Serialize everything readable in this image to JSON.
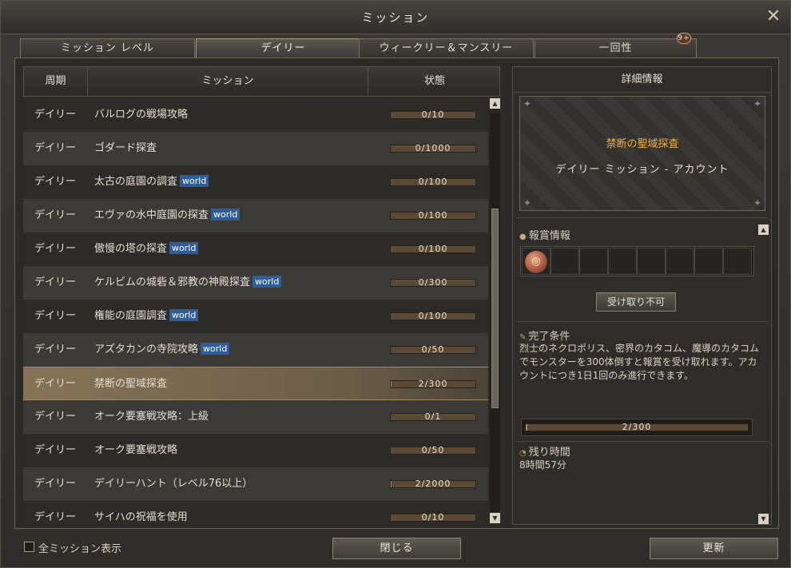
{
  "window": {
    "title": "ミッション",
    "close_glyph": "✕"
  },
  "tabs": [
    {
      "label": "ミッション レベル"
    },
    {
      "label": "デイリー"
    },
    {
      "label": "ウィークリー＆マンスリー"
    },
    {
      "label": "一回性",
      "badge": "9+"
    }
  ],
  "table": {
    "headers": [
      "周期",
      "ミッション",
      "状態"
    ],
    "rows": [
      {
        "period": "デイリー",
        "name": "バルログの戦場攻略",
        "world": "",
        "progress": "0/10",
        "ratio": 0
      },
      {
        "period": "デイリー",
        "name": "ゴダード探査",
        "world": "",
        "progress": "0/1000",
        "ratio": 0
      },
      {
        "period": "デイリー",
        "name": "太古の庭園の調査",
        "world": "world",
        "progress": "0/100",
        "ratio": 0
      },
      {
        "period": "デイリー",
        "name": "エヴァの水中庭園の探査",
        "world": "world",
        "progress": "0/100",
        "ratio": 0
      },
      {
        "period": "デイリー",
        "name": "傲慢の塔の探査",
        "world": "world",
        "progress": "0/100",
        "ratio": 0
      },
      {
        "period": "デイリー",
        "name": "ケルビムの城砦＆邪教の神殿探査",
        "world": "world",
        "progress": "0/300",
        "ratio": 0
      },
      {
        "period": "デイリー",
        "name": "権能の庭園調査",
        "world": "world",
        "progress": "0/100",
        "ratio": 0
      },
      {
        "period": "デイリー",
        "name": "アズタカンの寺院攻略",
        "world": "world",
        "progress": "0/50",
        "ratio": 0
      },
      {
        "period": "デイリー",
        "name": "禁断の聖域探査",
        "world": "",
        "progress": "2/300",
        "ratio": 0.0067
      },
      {
        "period": "デイリー",
        "name": "オーク要塞戦攻略：上級",
        "world": "",
        "progress": "0/1",
        "ratio": 0
      },
      {
        "period": "デイリー",
        "name": "オーク要塞戦攻略",
        "world": "",
        "progress": "0/50",
        "ratio": 0
      },
      {
        "period": "デイリー",
        "name": "デイリーハント（レベル76以上）",
        "world": "",
        "progress": "2/2000",
        "ratio": 0.001
      },
      {
        "period": "デイリー",
        "name": "サイハの祝福を使用",
        "world": "",
        "progress": "0/10",
        "ratio": 0
      }
    ]
  },
  "detail": {
    "title": "詳細情報",
    "mission_name": "禁断の聖域探査",
    "mission_type": "デイリー ミッション - アカウント",
    "reward_label": "報賞情報",
    "claim_label": "受け取り不可",
    "condition_label": "完了条件",
    "condition_text": "烈士のネクロポリス、密界のカタコム、魔導のカタコムでモンスターを300体倒すと報賞を受け取れます。アカウントにつき1日1回のみ進行できます。",
    "progress": "2/300",
    "progress_ratio": 0.0067,
    "time_label": "残り時間",
    "time_value": "8時間57分"
  },
  "footer": {
    "show_all_label": "全ミッション表示",
    "close_label": "閉じる",
    "refresh_label": "更新"
  },
  "colors": {
    "accent_gold": "#f0b030",
    "world_tag": "#2d5e99"
  },
  "icons": [
    "close-icon",
    "scroll-up-icon",
    "scroll-down-icon",
    "reward-item-icon",
    "coin-icon",
    "scroll-icon",
    "clock-icon"
  ]
}
